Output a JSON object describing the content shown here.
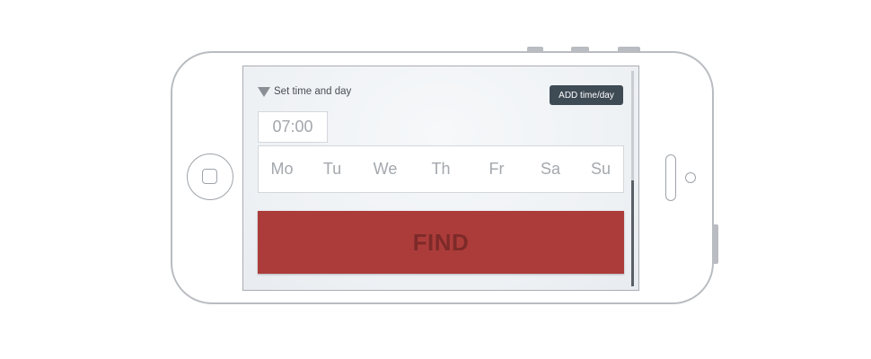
{
  "section": {
    "label": "Set time and day",
    "add_button_label": "ADD time/day"
  },
  "time": {
    "value": "07:00"
  },
  "days": [
    "Mo",
    "Tu",
    "We",
    "Th",
    "Fr",
    "Sa",
    "Su"
  ],
  "find_button_label": "FIND",
  "colors": {
    "accent": "#ac3c3a",
    "button_dark": "#3e4a54",
    "phone_outline": "#b9bcc0"
  },
  "icons": {
    "section_toggle": "triangle-down-icon"
  }
}
